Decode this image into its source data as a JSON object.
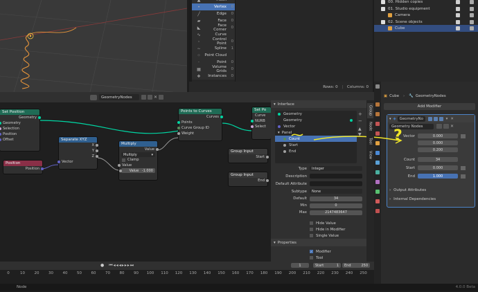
{
  "spreadsheet": {
    "items": [
      {
        "icon": "mesh-icon",
        "label": "Mesh",
        "count": ""
      },
      {
        "icon": "vertex-icon",
        "label": "Vertex",
        "count": "0",
        "selected": true
      },
      {
        "icon": "edge-icon",
        "label": "Edge",
        "count": "0"
      },
      {
        "icon": "face-icon",
        "label": "Face",
        "count": "0"
      },
      {
        "icon": "face-corner-icon",
        "label": "Face Corner",
        "count": "0"
      },
      {
        "icon": "curve-icon",
        "label": "Curve",
        "count": ""
      },
      {
        "icon": "control-point-icon",
        "label": "Control Point",
        "count": "0"
      },
      {
        "icon": "spline-icon",
        "label": "Spline",
        "count": "1"
      },
      {
        "icon": "point-cloud-icon",
        "label": "Point Cloud",
        "count": ""
      },
      {
        "icon": "point-icon",
        "label": "Point",
        "count": "0"
      },
      {
        "icon": "volume-grids-icon",
        "label": "Volume Grids",
        "count": "0"
      },
      {
        "icon": "instances-icon",
        "label": "Instances",
        "count": "0"
      }
    ],
    "rows_label": "Rows: 0",
    "columns_label": "Columns: 0"
  },
  "outliner": {
    "items": [
      {
        "label": "00. Hidden copies",
        "indent": 1
      },
      {
        "label": "01. Studio equipment",
        "indent": 1
      },
      {
        "label": "Camera",
        "indent": 2
      },
      {
        "label": "02. Scene objects",
        "indent": 1
      },
      {
        "label": "Cube",
        "indent": 2,
        "selected": true
      }
    ]
  },
  "node_editor": {
    "tree_name": "GeometryNodes",
    "nodes": {
      "set_position": {
        "title": "Set Position",
        "out": "Geometry",
        "inputs": [
          "Geometry",
          "Selection",
          "Position",
          "Offset"
        ]
      },
      "position": {
        "title": "Position",
        "out": "Position"
      },
      "separate": {
        "title": "Separate XYZ",
        "outs": [
          "X",
          "Y",
          "Z"
        ],
        "in": "Vector"
      },
      "multiply": {
        "title": "Multiply",
        "out": "Value",
        "mode": "Multiply",
        "clamp": "Clamp",
        "in": "Value",
        "value_label": "Value",
        "value": "-1.000"
      },
      "points_to_curves": {
        "title": "Points to Curves",
        "out": "Curves",
        "inputs": [
          "Points",
          "Curve Group ID",
          "Weight"
        ]
      },
      "set_position2": {
        "title": "Set Po",
        "rows": [
          "Curve",
          "NURB",
          "Select"
        ]
      },
      "group_input1": {
        "title": "Group Input",
        "out": "Start"
      },
      "group_input2": {
        "title": "Group Input",
        "out": "End"
      }
    }
  },
  "npanel": {
    "interface_header": "Interface",
    "items": [
      "Geometry",
      "Geometry",
      "Vector"
    ],
    "panel_label": "Panel",
    "panel_items": [
      "Count",
      "Start",
      "End"
    ],
    "props": [
      {
        "label": "Type",
        "value": "Integer"
      },
      {
        "label": "Description",
        "value": ""
      },
      {
        "label": "Default Attribute",
        "value": ""
      },
      {
        "label": "Subtype",
        "value": "None"
      },
      {
        "label": "Default",
        "value": "34"
      },
      {
        "label": "Min",
        "value": "0"
      },
      {
        "label": "Max",
        "value": "2147483647"
      }
    ],
    "checks": [
      {
        "label": "Hide Value",
        "checked": false
      },
      {
        "label": "Hide in Modifier",
        "checked": false
      },
      {
        "label": "Single Value",
        "checked": false
      }
    ],
    "properties_header": "Properties",
    "checks2": [
      {
        "label": "Modifier",
        "checked": true
      },
      {
        "label": "Tool",
        "checked": false
      }
    ],
    "tabs": [
      "Group",
      "Node",
      "Tool",
      "View"
    ]
  },
  "properties": {
    "breadcrumb_obj": "Cube",
    "breadcrumb_mod": "GeometryNodes",
    "add_modifier": "Add Modifier",
    "modifier_name": "GeometryNo",
    "tree_name": "Geometry Nodes",
    "vector_label": "Vector",
    "vector": [
      "0.000",
      "0.000",
      "0.200"
    ],
    "count_label": "Count",
    "count": "34",
    "start_label": "Start",
    "start": "0.000",
    "end_label": "End",
    "end": "1.000",
    "output_attributes": "Output Attributes",
    "internal_dependencies": "Internal Dependencies"
  },
  "timeline": {
    "frame": "1",
    "start_label": "Start",
    "start": "1",
    "end_label": "End",
    "end": "250",
    "ticks": [
      "0",
      "10",
      "20",
      "30",
      "40",
      "50",
      "60",
      "70",
      "80",
      "90",
      "100",
      "110",
      "120",
      "130",
      "140",
      "150",
      "160",
      "170",
      "180",
      "190",
      "200",
      "210",
      "220",
      "230",
      "240",
      "250"
    ]
  },
  "status": {
    "left": "Node",
    "version": "4.0.0 Beta"
  },
  "annotation": {
    "question": "?"
  },
  "colors": {
    "accent": "#4772b3",
    "yellow": "#f0e62a",
    "geo_link": "#00d6a3",
    "green": "#3c8a5a",
    "blue": "#2f5f8f"
  }
}
